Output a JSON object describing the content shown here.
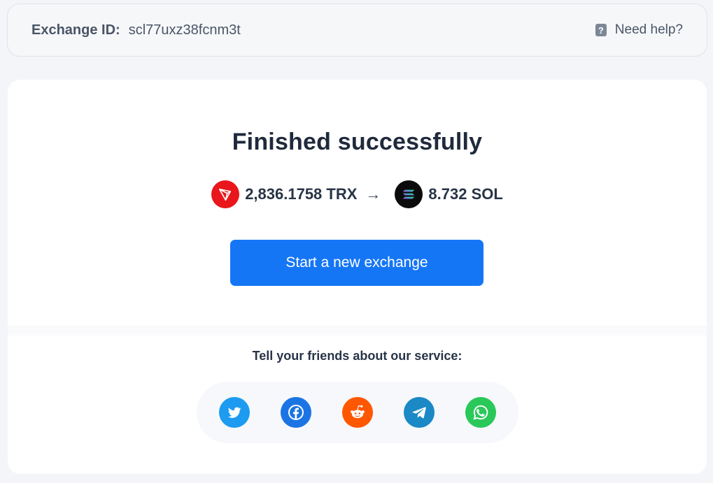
{
  "header": {
    "exchange_id_label": "Exchange ID:",
    "exchange_id_value": "scl77uxz38fcnm3t",
    "help_icon": "question-icon",
    "help_label": "Need help?"
  },
  "result": {
    "title": "Finished successfully",
    "from_amount": "2,836.1758 TRX",
    "from_icon": "tron-icon",
    "arrow": "→",
    "to_amount": "8.732 SOL",
    "to_icon": "solana-icon",
    "cta_label": "Start a new exchange"
  },
  "share": {
    "title": "Tell your friends about our service:",
    "networks": [
      "twitter",
      "facebook",
      "reddit",
      "telegram",
      "whatsapp"
    ]
  },
  "colors": {
    "accent": "#1576f5",
    "tron": "#e9161b",
    "solana": "#0b0b0b",
    "twitter": "#1d9bf0",
    "facebook": "#1b74e4",
    "reddit": "#ff5700",
    "telegram": "#1a89c5",
    "whatsapp": "#29c859"
  }
}
